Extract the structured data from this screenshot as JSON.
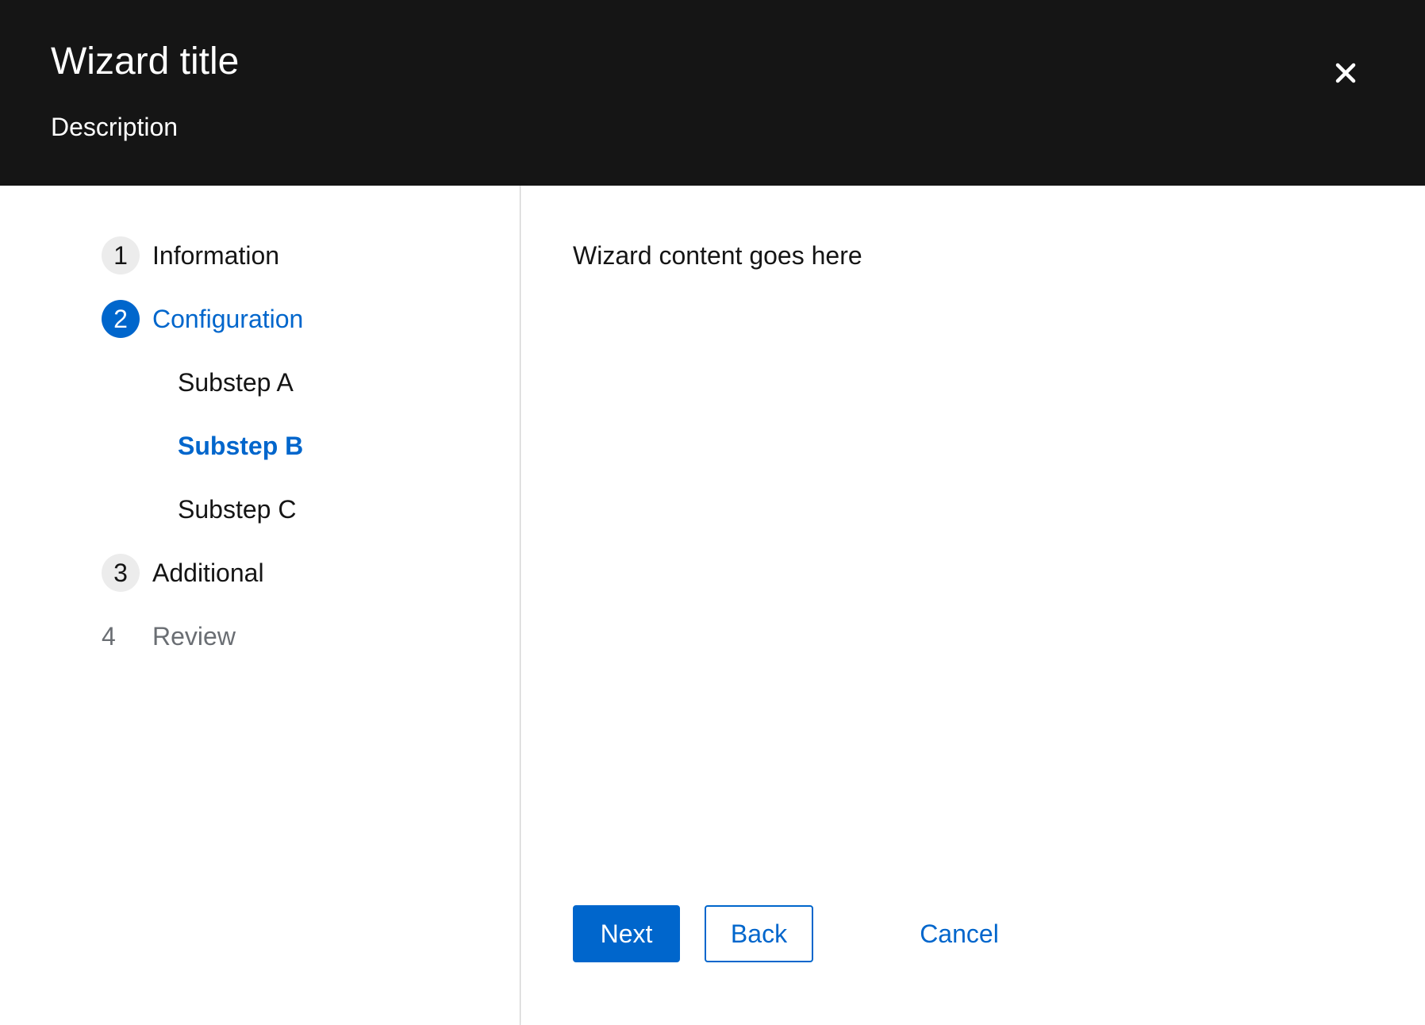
{
  "header": {
    "title": "Wizard title",
    "description": "Description",
    "close_icon": "close-icon"
  },
  "nav": {
    "steps": [
      {
        "number": "1",
        "label": "Information",
        "state": "default"
      },
      {
        "number": "2",
        "label": "Configuration",
        "state": "current",
        "substeps": [
          {
            "label": "Substep A",
            "state": "default"
          },
          {
            "label": "Substep B",
            "state": "current"
          },
          {
            "label": "Substep C",
            "state": "default"
          }
        ]
      },
      {
        "number": "3",
        "label": "Additional",
        "state": "default"
      },
      {
        "number": "4",
        "label": "Review",
        "state": "disabled"
      }
    ]
  },
  "main": {
    "content_text": "Wizard content goes here"
  },
  "footer": {
    "next_label": "Next",
    "back_label": "Back",
    "cancel_label": "Cancel"
  },
  "colors": {
    "header_bg": "#151515",
    "accent": "#0066cc",
    "text": "#151515",
    "disabled_text": "#6a6e73",
    "step_bubble": "#ececec"
  }
}
